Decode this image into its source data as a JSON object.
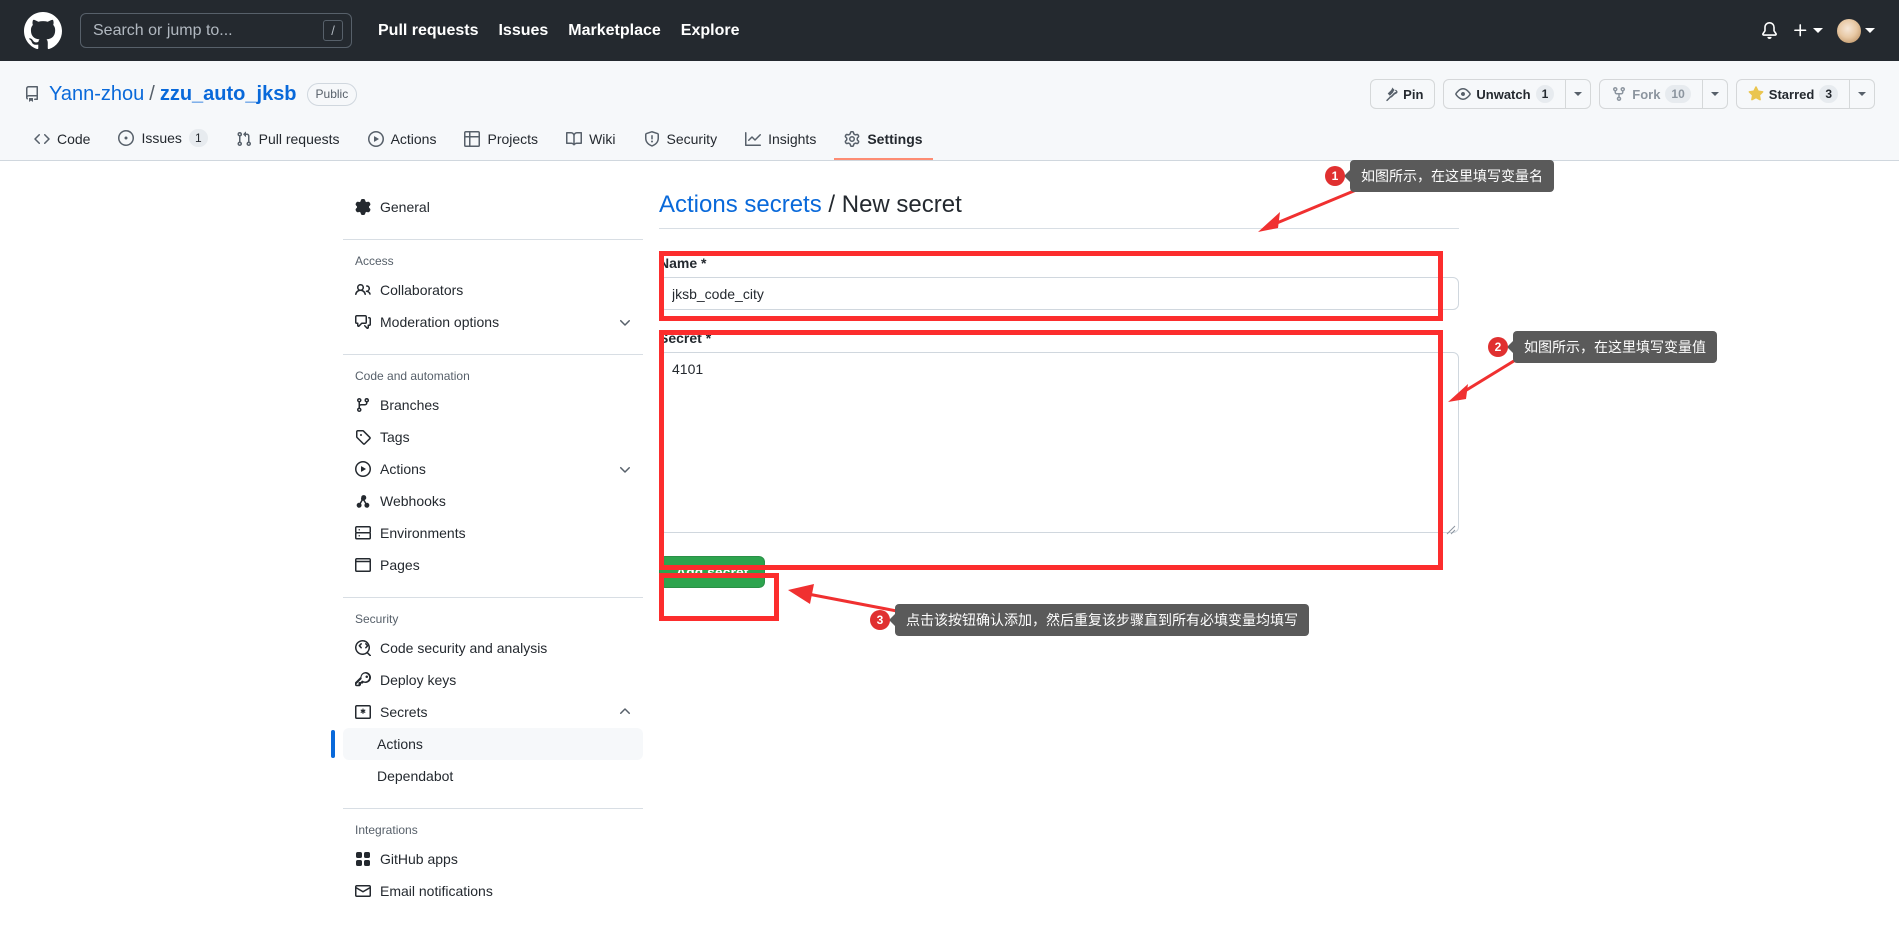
{
  "topbar": {
    "logo_icon": "github-logo-icon",
    "search": {
      "placeholder": "Search or jump to...",
      "shortcut": "/"
    },
    "nav": [
      {
        "label": "Pull requests"
      },
      {
        "label": "Issues"
      },
      {
        "label": "Marketplace"
      },
      {
        "label": "Explore"
      }
    ],
    "icons": {
      "notifications": "bell-icon",
      "create_new": "plus-icon",
      "account": "avatar"
    }
  },
  "repo": {
    "icon": "repo-icon",
    "owner": "Yann-zhou",
    "separator": "/",
    "name": "zzu_auto_jksb",
    "visibility": "Public",
    "actions": {
      "pin": {
        "label": "Pin",
        "icon": "pin-icon"
      },
      "watch": {
        "label": "Unwatch",
        "count": "1",
        "icon": "eye-icon"
      },
      "fork": {
        "label": "Fork",
        "count": "10",
        "icon": "fork-icon"
      },
      "star": {
        "label": "Starred",
        "count": "3",
        "icon": "star-icon"
      }
    },
    "tabs": [
      {
        "label": "Code",
        "icon": "code-icon",
        "count": null,
        "selected": false
      },
      {
        "label": "Issues",
        "icon": "issue-opened-icon",
        "count": "1",
        "selected": false
      },
      {
        "label": "Pull requests",
        "icon": "git-pull-request-icon",
        "count": null,
        "selected": false
      },
      {
        "label": "Actions",
        "icon": "play-icon",
        "count": null,
        "selected": false
      },
      {
        "label": "Projects",
        "icon": "table-icon",
        "count": null,
        "selected": false
      },
      {
        "label": "Wiki",
        "icon": "book-icon",
        "count": null,
        "selected": false
      },
      {
        "label": "Security",
        "icon": "shield-icon",
        "count": null,
        "selected": false
      },
      {
        "label": "Insights",
        "icon": "graph-icon",
        "count": null,
        "selected": false
      },
      {
        "label": "Settings",
        "icon": "gear-icon",
        "count": null,
        "selected": true
      }
    ]
  },
  "sidebar": {
    "general": {
      "label": "General",
      "icon": "gear-icon"
    },
    "groups": [
      {
        "heading": "Access",
        "items": [
          {
            "label": "Collaborators",
            "icon": "people-icon",
            "expandable": false
          },
          {
            "label": "Moderation options",
            "icon": "comment-discussion-icon",
            "expandable": true
          }
        ]
      },
      {
        "heading": "Code and automation",
        "items": [
          {
            "label": "Branches",
            "icon": "git-branch-icon",
            "expandable": false
          },
          {
            "label": "Tags",
            "icon": "tag-icon",
            "expandable": false
          },
          {
            "label": "Actions",
            "icon": "play-icon",
            "expandable": true
          },
          {
            "label": "Webhooks",
            "icon": "webhook-icon",
            "expandable": false
          },
          {
            "label": "Environments",
            "icon": "server-icon",
            "expandable": false
          },
          {
            "label": "Pages",
            "icon": "browser-icon",
            "expandable": false
          }
        ]
      },
      {
        "heading": "Security",
        "items": [
          {
            "label": "Code security and analysis",
            "icon": "codescan-icon",
            "expandable": false
          },
          {
            "label": "Deploy keys",
            "icon": "key-icon",
            "expandable": false
          },
          {
            "label": "Secrets",
            "icon": "secret-icon",
            "expandable": true,
            "expanded": true
          }
        ],
        "subitems": [
          {
            "label": "Actions",
            "active": true
          },
          {
            "label": "Dependabot",
            "active": false
          }
        ]
      },
      {
        "heading": "Integrations",
        "items": [
          {
            "label": "GitHub apps",
            "icon": "apps-icon",
            "expandable": false
          },
          {
            "label": "Email notifications",
            "icon": "mail-icon",
            "expandable": false
          }
        ]
      }
    ]
  },
  "main": {
    "breadcrumb_link": "Actions secrets",
    "breadcrumb_sep": " / ",
    "breadcrumb_current": "New secret",
    "name_field": {
      "label": "Name *",
      "value": "jksb_code_city"
    },
    "secret_field": {
      "label": "Secret *",
      "value": "4101"
    },
    "submit_button": "Add secret"
  },
  "annotations": [
    {
      "num": "1",
      "text": "如图所示，在这里填写变量名"
    },
    {
      "num": "2",
      "text": "如图所示，在这里填写变量值"
    },
    {
      "num": "3",
      "text": "点击该按钮确认添加，然后重复该步骤直到所有必填变量均填写"
    }
  ],
  "colors": {
    "header_bg": "#24292f",
    "accent_link": "#0969da",
    "primary_button": "#2da44e",
    "highlight_red": "#fc2d2d",
    "annotation_bubble": "#5a5a5a",
    "annotation_badge": "#e03030",
    "tab_underline": "#fd8c73",
    "star_yellow": "#eac54f"
  }
}
